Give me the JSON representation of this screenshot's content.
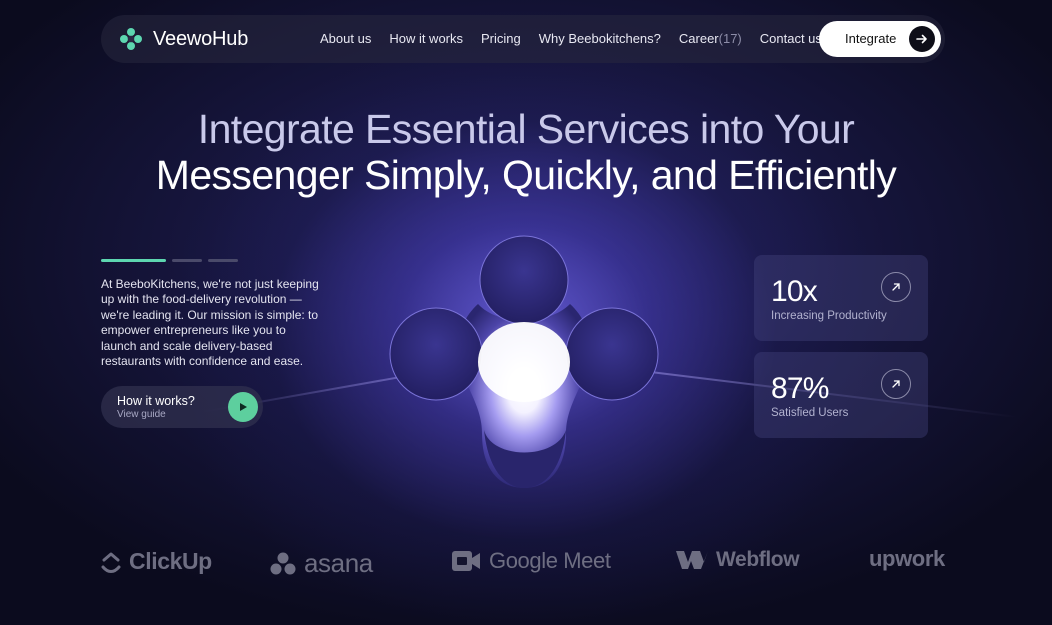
{
  "nav": {
    "brand": "VeewoHub",
    "links": [
      {
        "label": "About us"
      },
      {
        "label": "How it works"
      },
      {
        "label": "Pricing"
      },
      {
        "label": "Why Beebokitchens?"
      },
      {
        "label": "Career",
        "count": "(17)"
      },
      {
        "label": "Contact us"
      }
    ],
    "cta_label": "Integrate"
  },
  "hero": {
    "line1": "Integrate Essential Services into Your",
    "line2": "Messenger Simply, Quickly, and Efficiently"
  },
  "intro": {
    "text": "At BeeboKitchens, we're not just keeping up with the food-delivery revolution — we're leading it. Our mission is simple: to empower entrepreneurs like you to launch and scale delivery-based restaurants with confidence and ease.",
    "progress": {
      "active_index": 0,
      "total": 3
    }
  },
  "how_button": {
    "title": "How it works?",
    "subtitle": "View guide"
  },
  "stats": [
    {
      "value": "10x",
      "label": "Increasing Productivity"
    },
    {
      "value": "87%",
      "label": "Satisfied Users"
    }
  ],
  "logos": [
    {
      "name": "clickup",
      "label": "ClickUp"
    },
    {
      "name": "asana",
      "label": "asana"
    },
    {
      "name": "google-meet",
      "label": "Google Meet"
    },
    {
      "name": "webflow",
      "label": "Webflow"
    },
    {
      "name": "upwork",
      "label": "upwork"
    }
  ],
  "colors": {
    "accent": "#5dd6b0",
    "play_button": "#5dcf9e",
    "background": "#0b0b1e",
    "glow": "#6e64e6"
  }
}
